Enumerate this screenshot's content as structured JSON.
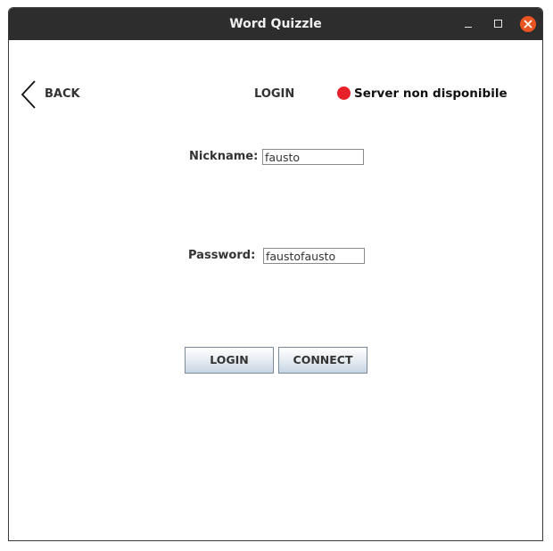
{
  "window": {
    "title": "Word Quizzle"
  },
  "nav": {
    "back_label": "BACK",
    "page_title": "LOGIN"
  },
  "server_status": {
    "text": "Server non disponibile",
    "indicator_color": "#e8202a"
  },
  "form": {
    "nickname_label": "Nickname:",
    "nickname_value": "fausto",
    "password_label": "Password:",
    "password_value": "faustofausto"
  },
  "buttons": {
    "login_label": "LOGIN",
    "connect_label": "CONNECT"
  },
  "colors": {
    "titlebar": "#2d2d2d",
    "close_button": "#e95420"
  }
}
